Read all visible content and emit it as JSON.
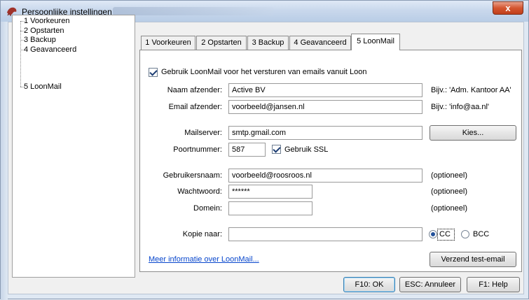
{
  "window": {
    "title": "Persoonlijke instellingen",
    "close_label": "x"
  },
  "tree": {
    "items": [
      {
        "label": "1 Voorkeuren",
        "selected": false
      },
      {
        "label": "2 Opstarten",
        "selected": false
      },
      {
        "label": "3 Backup",
        "selected": false
      },
      {
        "label": "4 Geavanceerd",
        "selected": false
      },
      {
        "label": "5 LoonMail",
        "selected": true
      }
    ]
  },
  "tabs": [
    {
      "label": "1 Voorkeuren"
    },
    {
      "label": "2 Opstarten"
    },
    {
      "label": "3 Backup"
    },
    {
      "label": "4 Geavanceerd"
    },
    {
      "label": "5 LoonMail",
      "active": true
    }
  ],
  "loonmail": {
    "use_checkbox": {
      "label": "Gebruik LoonMail voor het versturen van emails vanuit Loon",
      "checked": true
    },
    "sender_name": {
      "label": "Naam afzender:",
      "value": "Active  BV",
      "hint": "Bijv.: 'Adm. Kantoor AA'"
    },
    "sender_email": {
      "label": "Email afzender:",
      "value": "voorbeeld@jansen.nl",
      "hint": "Bijv.: 'info@aa.nl'"
    },
    "mailserver": {
      "label": "Mailserver:",
      "value": "smtp.gmail.com",
      "button": "Kies..."
    },
    "port": {
      "label": "Poortnummer:",
      "value": "587"
    },
    "ssl": {
      "label": "Gebruik SSL",
      "checked": true
    },
    "username": {
      "label": "Gebruikersnaam:",
      "value": "voorbeeld@roosroos.nl",
      "hint": "(optioneel)"
    },
    "password": {
      "label": "Wachtwoord:",
      "value": "******",
      "hint": "(optioneel)"
    },
    "domain": {
      "label": "Domein:",
      "value": "",
      "hint": "(optioneel)"
    },
    "copy_to": {
      "label": "Kopie naar:",
      "value": ""
    },
    "copy_mode": {
      "cc_label": "CC",
      "bcc_label": "BCC",
      "selected": "CC"
    },
    "info_link": "Meer informatie over LoonMail...",
    "test_button": "Verzend test-email"
  },
  "footer": {
    "ok": "F10: OK",
    "cancel": "ESC: Annuleer",
    "help": "F1: Help"
  },
  "colors": {
    "link": "#0645cc",
    "close_button": "#d4552f",
    "title_gradient": "#c9d8ec"
  }
}
